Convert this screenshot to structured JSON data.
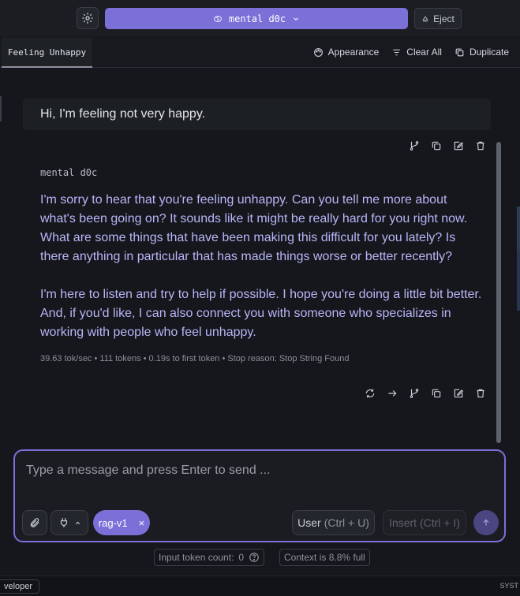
{
  "topbar": {
    "model_name": "mental d0c",
    "eject_label": "Eject"
  },
  "tabs": {
    "active_tab": "Feeling Unhappy",
    "actions": {
      "appearance": "Appearance",
      "clear_all": "Clear All",
      "duplicate": "Duplicate"
    }
  },
  "chat": {
    "user_message": "Hi, I'm feeling not very happy.",
    "assistant_name": "mental d0c",
    "assistant_paragraphs": [
      "I'm sorry to hear that you're feeling unhappy. Can you tell me more about what's been going on? It sounds like it might be really hard for you right now. What are some things that have been making this difficult for you lately? Is there anything in particular that has made things worse or better recently?",
      "I'm here to listen and try to help if possible. I hope you're doing a little bit better. And, if you'd like, I can also connect you with someone who specializes in working with people who feel unhappy."
    ],
    "stats": "39.63 tok/sec • 111 tokens • 0.19s to first token • Stop reason: Stop String Found"
  },
  "composer": {
    "placeholder": "Type a message and press Enter to send ...",
    "rag_chip": "rag-v1",
    "rag_chip_close": "×",
    "user_label": "User",
    "user_hint": "(Ctrl + U)",
    "insert_label": "Insert (Ctrl + I)"
  },
  "footer": {
    "input_token_label": "Input token count:",
    "input_token_value": "0",
    "context_label": "Context is 8.8% full"
  },
  "statusbar": {
    "mode_label": "veloper",
    "sys_text": "SYST"
  },
  "colors": {
    "accent": "#7b6fd8",
    "assistant_text": "#b8b6f8",
    "background": "#15171c"
  },
  "icons": [
    "gear-icon",
    "brain-icon",
    "chevron-down-icon",
    "eject-icon",
    "palette-icon",
    "clear-icon",
    "duplicate-icon",
    "branch-icon",
    "copy-icon",
    "edit-icon",
    "trash-icon",
    "regenerate-icon",
    "continue-icon",
    "paperclip-icon",
    "plug-icon",
    "chevron-up-icon",
    "arrow-up-icon",
    "help-icon"
  ]
}
